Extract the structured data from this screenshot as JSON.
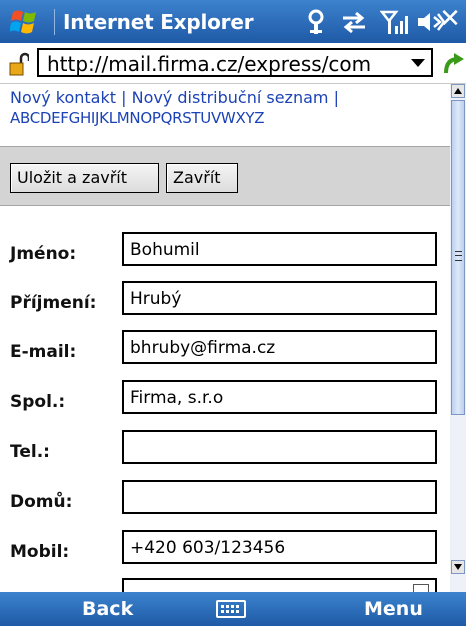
{
  "title_bar": {
    "app_title": "Internet Explorer",
    "icons": [
      "windows-logo-icon",
      "antenna-icon",
      "sync-icon",
      "signal-icon",
      "volume-icon",
      "close-icon"
    ]
  },
  "address_bar": {
    "url": "http://mail.firma.cz/express/com"
  },
  "links": {
    "new_contact": "Nový kontakt",
    "separator1": " | ",
    "new_distribution_list": "Nový distribuční seznam",
    "separator2": " |",
    "alphabet": "ABCDEFGHIJKLMNOPQRSTUVWXYZ"
  },
  "buttons": {
    "save_close": "Uložit a zavřít",
    "close": "Zavřít"
  },
  "form": {
    "fields": [
      {
        "label": "Jméno:",
        "value": "Bohumil"
      },
      {
        "label": "Příjmení:",
        "value": "Hrubý"
      },
      {
        "label": "E-mail:",
        "value": "bhruby@firma.cz"
      },
      {
        "label": "Spol.:",
        "value": "Firma, s.r.o"
      },
      {
        "label": "Tel.:",
        "value": ""
      },
      {
        "label": "Domů:",
        "value": ""
      },
      {
        "label": "Mobil:",
        "value": "+420 603/123456"
      }
    ]
  },
  "softkeys": {
    "left": "Back",
    "right": "Menu"
  },
  "colors": {
    "title_bar": "#2f6fbc",
    "link": "#1c43b6",
    "button_bar": "#d4d4d4"
  }
}
